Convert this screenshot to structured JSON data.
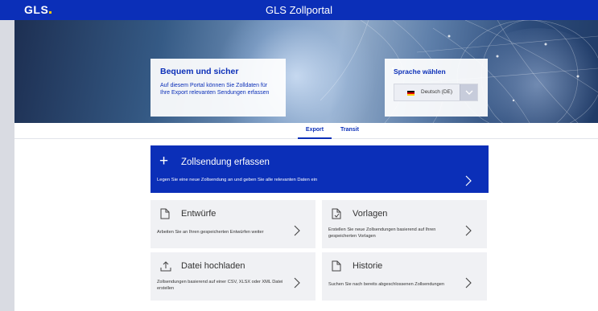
{
  "header": {
    "logo": "GLS",
    "title": "GLS Zollportal"
  },
  "hero": {
    "intro_title": "Bequem und sicher",
    "intro_text": "Auf diesem Portal können Sie Zolldaten für Ihre Export relevanten Sendungen erfassen",
    "language_title": "Sprache wählen",
    "language_value": "Deutsch (DE)"
  },
  "tabs": [
    {
      "label": "Export",
      "active": true
    },
    {
      "label": "Transit",
      "active": false
    }
  ],
  "primary_action": {
    "title": "Zollsendung erfassen",
    "description": "Legen Sie eine neue Zollsendung an und geben Sie alle relevanten Daten ein",
    "icon": "plus-icon"
  },
  "actions": [
    {
      "title": "Entwürfe",
      "description": "Arbeiten Sie an Ihren gespeicherten Entwürfen weiter",
      "icon": "document-icon"
    },
    {
      "title": "Vorlagen",
      "description": "Erstellen Sie neue Zollsendungen basierend auf Ihren gespeicherten Vorlagen",
      "icon": "template-document-icon"
    },
    {
      "title": "Datei hochladen",
      "description": "Zollsendungen basierend auf einer CSV, XLSX oder XML Datei erstellen",
      "icon": "upload-icon"
    },
    {
      "title": "Historie",
      "description": "Suchen Sie nach bereits abgeschlossenen Zollsendungen",
      "icon": "document-icon"
    }
  ],
  "colors": {
    "brand_blue": "#0b2fb8",
    "card_bg": "#f0f1f4",
    "logo_dot": "#f7c600"
  }
}
